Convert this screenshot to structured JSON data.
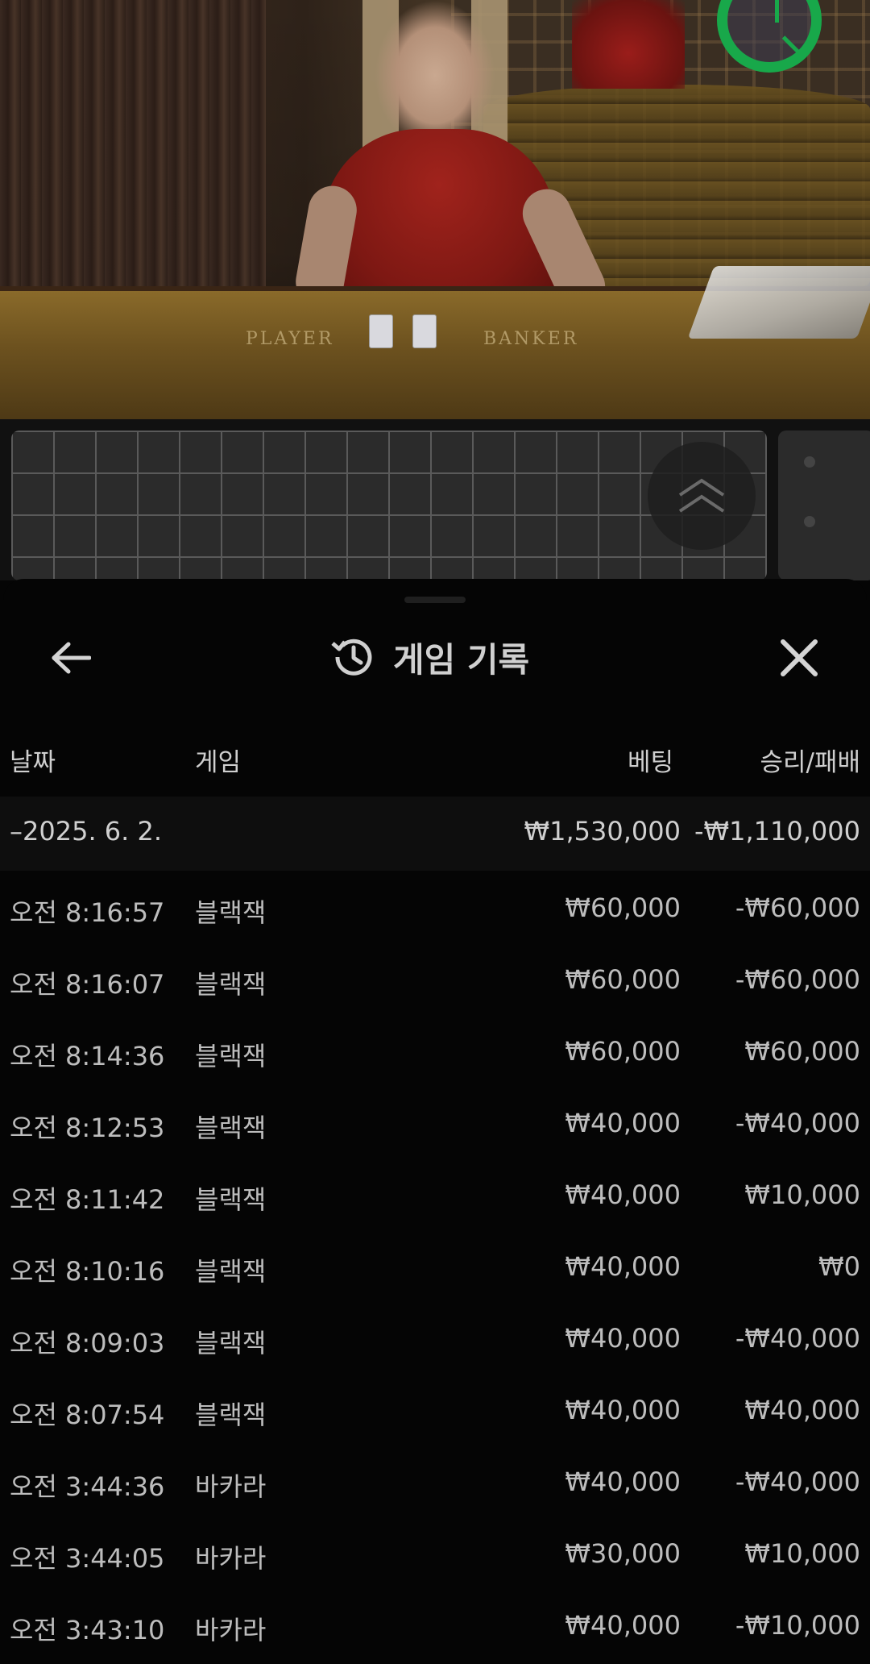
{
  "video": {
    "table_labels": {
      "player": "PLAYER",
      "banker": "BANKER"
    }
  },
  "header": {
    "title": "게임 기록",
    "back_icon": "arrow-left-icon",
    "history_icon": "history-clock-icon",
    "close_icon": "close-icon"
  },
  "columns": {
    "date": "날짜",
    "game": "게임",
    "bet": "베팅",
    "result": "승리/패배"
  },
  "group": {
    "date": "–2025. 6. 2.",
    "bet_total": "₩1,530,000",
    "result_total": "-₩1,110,000"
  },
  "rows": [
    {
      "time": "오전 8:16:57",
      "game": "블랙잭",
      "bet": "₩60,000",
      "result": "-₩60,000"
    },
    {
      "time": "오전 8:16:07",
      "game": "블랙잭",
      "bet": "₩60,000",
      "result": "-₩60,000"
    },
    {
      "time": "오전 8:14:36",
      "game": "블랙잭",
      "bet": "₩60,000",
      "result": "₩60,000"
    },
    {
      "time": "오전 8:12:53",
      "game": "블랙잭",
      "bet": "₩40,000",
      "result": "-₩40,000"
    },
    {
      "time": "오전 8:11:42",
      "game": "블랙잭",
      "bet": "₩40,000",
      "result": "₩10,000"
    },
    {
      "time": "오전 8:10:16",
      "game": "블랙잭",
      "bet": "₩40,000",
      "result": "₩0"
    },
    {
      "time": "오전 8:09:03",
      "game": "블랙잭",
      "bet": "₩40,000",
      "result": "-₩40,000"
    },
    {
      "time": "오전 8:07:54",
      "game": "블랙잭",
      "bet": "₩40,000",
      "result": "₩40,000"
    },
    {
      "time": "오전 3:44:36",
      "game": "바카라",
      "bet": "₩40,000",
      "result": "-₩40,000"
    },
    {
      "time": "오전 3:44:05",
      "game": "바카라",
      "bet": "₩30,000",
      "result": "₩10,000"
    },
    {
      "time": "오전 3:43:10",
      "game": "바카라",
      "bet": "₩40,000",
      "result": "-₩10,000"
    }
  ],
  "colors": {
    "timer_green": "#18a84a",
    "sheet_bg": "#050505",
    "text": "#bdbdbd"
  }
}
